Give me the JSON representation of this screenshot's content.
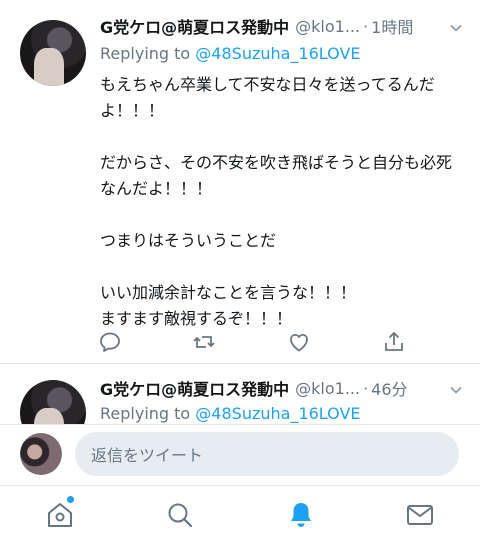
{
  "tweets": [
    {
      "author_name": "G党ケロ@萌夏ロス発動中",
      "handle": "@klo1...",
      "separator": "·",
      "time": "1時間",
      "reply_prefix": "Replying to",
      "reply_to": "@48Suzuha_16LOVE",
      "text": "もえちゃん卒業して不安な日々を送ってるんだよ！！！\n\nだからさ、その不安を吹き飛ばそうと自分も必死なんだよ！！！\n\nつまりはそういうことだ\n\nいい加減余計なことを言うな！！！\nますます敵視するぞ！！！"
    },
    {
      "author_name": "G党ケロ@萌夏ロス発動中",
      "handle": "@klo1...",
      "separator": "·",
      "time": "46分",
      "reply_prefix": "Replying to",
      "reply_to": "@48Suzuha_16LOVE"
    }
  ],
  "composer": {
    "placeholder": "返信をツイート"
  },
  "icons": {
    "reply": "reply-icon",
    "retweet": "retweet-icon",
    "like": "heart-icon",
    "share": "share-icon",
    "chevron": "chevron-down-icon",
    "tabs": [
      "home-icon",
      "search-icon",
      "notifications-icon",
      "messages-icon"
    ]
  },
  "colors": {
    "accent": "#1da1f2",
    "muted": "#657786",
    "text": "#14171a",
    "border": "#e1e8ed"
  },
  "active_tab": "notifications"
}
